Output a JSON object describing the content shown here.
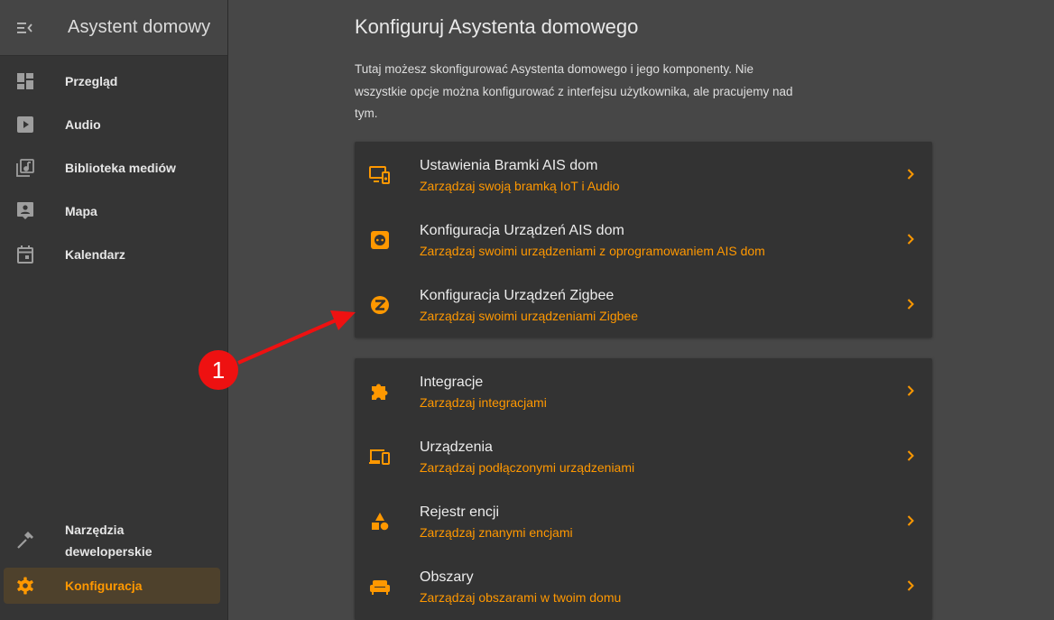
{
  "sidebar": {
    "title": "Asystent domowy",
    "toggle_icon": "menu-open-icon",
    "items": [
      {
        "label": "Przegląd",
        "icon": "dashboard-icon"
      },
      {
        "label": "Audio",
        "icon": "play-box-icon"
      },
      {
        "label": "Biblioteka mediów",
        "icon": "music-library-icon"
      },
      {
        "label": "Mapa",
        "icon": "account-box-icon"
      },
      {
        "label": "Kalendarz",
        "icon": "calendar-icon"
      }
    ],
    "bottom_items": [
      {
        "label": "Narzędzia deweloperskie",
        "icon": "hammer-icon"
      },
      {
        "label": "Konfiguracja",
        "icon": "gear-icon",
        "active": true
      }
    ]
  },
  "main": {
    "title": "Konfiguruj Asystenta domowego",
    "description": "Tutaj możesz skonfigurować Asystenta domowego i jego komponenty. Nie wszystkie opcje można konfigurować z interfejsu użytkownika, ale pracujemy nad tym.",
    "card1": [
      {
        "title": "Ustawienia Bramki AIS dom",
        "subtitle": "Zarządzaj swoją bramką IoT i Audio",
        "icon": "monitor-speaker-icon"
      },
      {
        "title": "Konfiguracja Urządzeń AIS dom",
        "subtitle": "Zarządzaj swoimi urządzeniami z oprogramowaniem AIS dom",
        "icon": "power-socket-icon"
      },
      {
        "title": "Konfiguracja Urządzeń Zigbee",
        "subtitle": "Zarządzaj swoimi urządzeniami Zigbee",
        "icon": "zigbee-icon"
      }
    ],
    "card2": [
      {
        "title": "Integracje",
        "subtitle": "Zarządzaj integracjami",
        "icon": "puzzle-icon"
      },
      {
        "title": "Urządzenia",
        "subtitle": "Zarządzaj podłączonymi urządzeniami",
        "icon": "devices-icon"
      },
      {
        "title": "Rejestr encji",
        "subtitle": "Zarządzaj znanymi encjami",
        "icon": "shapes-icon"
      },
      {
        "title": "Obszary",
        "subtitle": "Zarządzaj obszarami w twoim domu",
        "icon": "sofa-icon"
      }
    ]
  },
  "annotation": {
    "badge": "1"
  },
  "colors": {
    "accent": "#ff9800",
    "sidebar": "#353535",
    "background": "#474747",
    "card": "#333333",
    "annotation": "#ee1111"
  }
}
